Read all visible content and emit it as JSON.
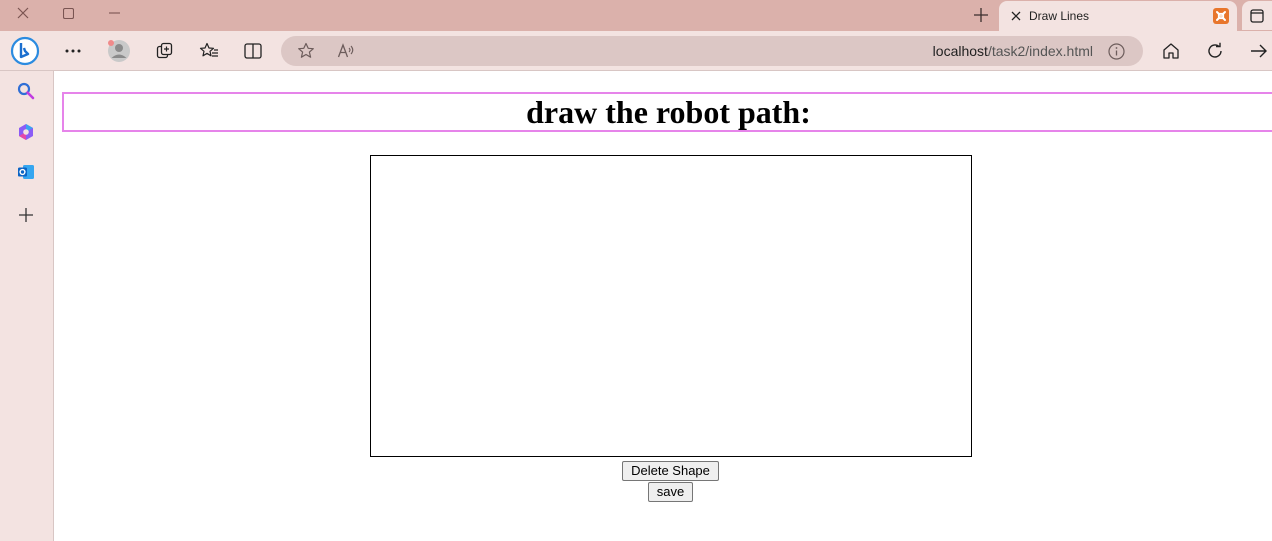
{
  "browser": {
    "tab": {
      "title": "Draw Lines",
      "favicon": "xampp-icon"
    },
    "address_bar": {
      "host": "localhost",
      "path": "/task2/index.html"
    },
    "colors": {
      "titlebar": "#dbb1ab",
      "toolbar": "#f3e3e1",
      "address_bar": "#dcc7c5",
      "favicon": "#e8762c"
    }
  },
  "page": {
    "heading": "draw the robot path:",
    "heading_border_color": "#e684ea",
    "buttons": {
      "delete_label": "Delete Shape",
      "save_label": "save"
    }
  }
}
